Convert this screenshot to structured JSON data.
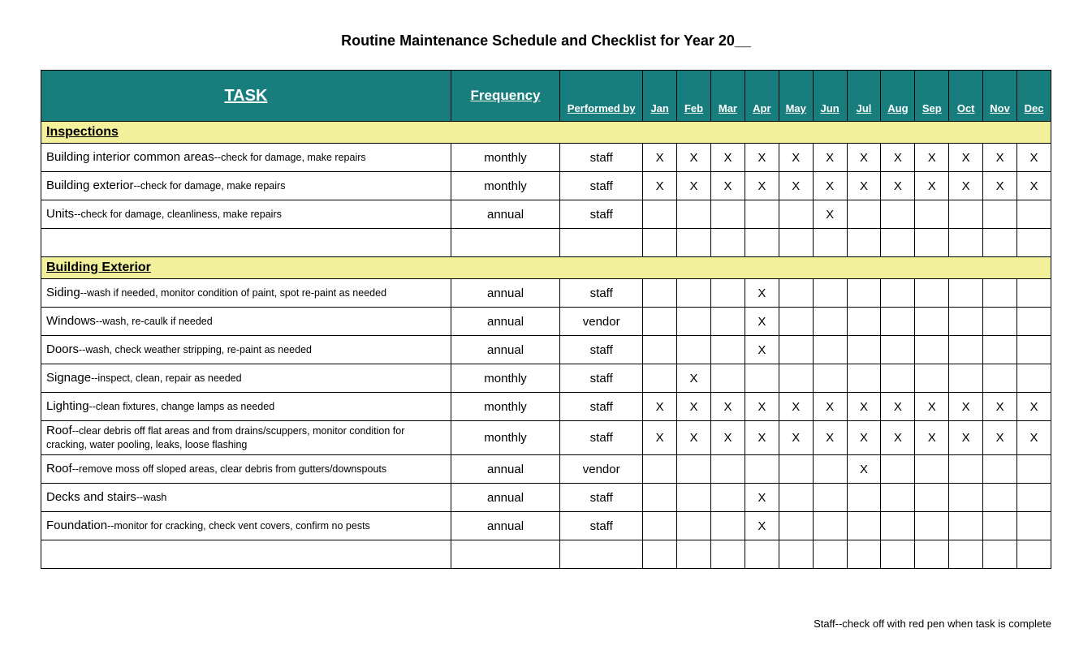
{
  "title": "Routine Maintenance Schedule and Checklist for Year 20__",
  "columns": {
    "task": "TASK",
    "frequency": "Frequency",
    "performed_by": "Performed by",
    "months": [
      "Jan",
      "Feb",
      "Mar",
      "Apr",
      "May",
      "Jun",
      "Jul",
      "Aug",
      "Sep",
      "Oct",
      "Nov",
      "Dec"
    ]
  },
  "mark": "X",
  "sections": [
    {
      "name": "Inspections",
      "rows": [
        {
          "task_main": "Building interior common areas",
          "task_sub": "--check for damage, make repairs",
          "frequency": "monthly",
          "performed_by": "staff",
          "months": [
            true,
            true,
            true,
            true,
            true,
            true,
            true,
            true,
            true,
            true,
            true,
            true
          ]
        },
        {
          "task_main": "Building exterior",
          "task_sub": "--check for damage, make repairs",
          "frequency": "monthly",
          "performed_by": "staff",
          "months": [
            true,
            true,
            true,
            true,
            true,
            true,
            true,
            true,
            true,
            true,
            true,
            true
          ]
        },
        {
          "task_main": "Units",
          "task_sub": "--check for damage, cleanliness, make repairs",
          "frequency": "annual",
          "performed_by": "staff",
          "months": [
            false,
            false,
            false,
            false,
            false,
            true,
            false,
            false,
            false,
            false,
            false,
            false
          ]
        }
      ],
      "trailing_blank": true
    },
    {
      "name": "Building Exterior",
      "rows": [
        {
          "task_main": "Siding",
          "task_sub": "--wash if needed, monitor condition of paint, spot re-paint as needed",
          "frequency": "annual",
          "performed_by": "staff",
          "months": [
            false,
            false,
            false,
            true,
            false,
            false,
            false,
            false,
            false,
            false,
            false,
            false
          ]
        },
        {
          "task_main": "Windows",
          "task_sub": "--wash, re-caulk if needed",
          "frequency": "annual",
          "performed_by": "vendor",
          "months": [
            false,
            false,
            false,
            true,
            false,
            false,
            false,
            false,
            false,
            false,
            false,
            false
          ]
        },
        {
          "task_main": "Doors",
          "task_sub": "--wash, check weather stripping, re-paint as needed",
          "frequency": "annual",
          "performed_by": "staff",
          "months": [
            false,
            false,
            false,
            true,
            false,
            false,
            false,
            false,
            false,
            false,
            false,
            false
          ]
        },
        {
          "task_main": "Signage",
          "task_sub": "--inspect, clean, repair as needed",
          "frequency": "monthly",
          "performed_by": "staff",
          "months": [
            false,
            true,
            false,
            false,
            false,
            false,
            false,
            false,
            false,
            false,
            false,
            false
          ]
        },
        {
          "task_main": "Lighting",
          "task_sub": "--clean fixtures, change lamps as needed",
          "frequency": "monthly",
          "performed_by": "staff",
          "months": [
            true,
            true,
            true,
            true,
            true,
            true,
            true,
            true,
            true,
            true,
            true,
            true
          ]
        },
        {
          "task_main": "Roof",
          "task_sub": "--clear debris off flat areas and from drains/scuppers, monitor condition for cracking, water pooling, leaks, loose flashing",
          "frequency": "monthly",
          "performed_by": "staff",
          "months": [
            true,
            true,
            true,
            true,
            true,
            true,
            true,
            true,
            true,
            true,
            true,
            true
          ]
        },
        {
          "task_main": "Roof",
          "task_sub": "--remove moss off sloped areas, clear debris from gutters/downspouts",
          "frequency": "annual",
          "performed_by": "vendor",
          "months": [
            false,
            false,
            false,
            false,
            false,
            false,
            true,
            false,
            false,
            false,
            false,
            false
          ]
        },
        {
          "task_main": "Decks and stairs",
          "task_sub": "--wash",
          "frequency": "annual",
          "performed_by": "staff",
          "months": [
            false,
            false,
            false,
            true,
            false,
            false,
            false,
            false,
            false,
            false,
            false,
            false
          ]
        },
        {
          "task_main": "Foundation",
          "task_sub": "--monitor for cracking, check vent covers, confirm no pests",
          "frequency": "annual",
          "performed_by": "staff",
          "months": [
            false,
            false,
            false,
            true,
            false,
            false,
            false,
            false,
            false,
            false,
            false,
            false
          ]
        }
      ],
      "trailing_blank": true
    }
  ],
  "footer_note": "Staff--check off with red pen when task is complete"
}
